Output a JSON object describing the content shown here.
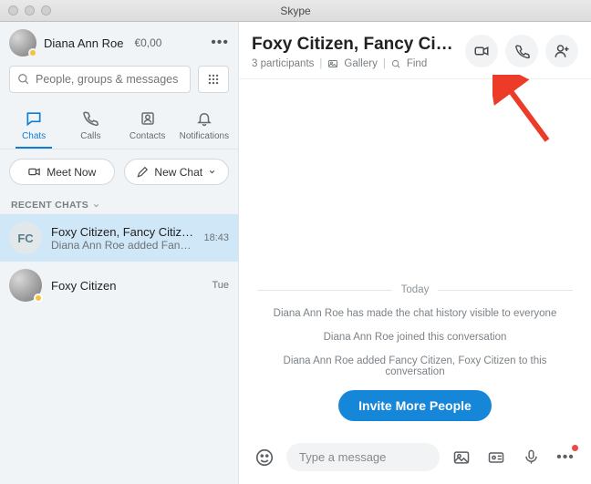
{
  "window": {
    "title": "Skype"
  },
  "me": {
    "name": "Diana Ann Roe",
    "balance": "€0,00"
  },
  "search": {
    "placeholder": "People, groups & messages"
  },
  "tabs": [
    {
      "id": "chats",
      "label": "Chats"
    },
    {
      "id": "calls",
      "label": "Calls"
    },
    {
      "id": "contacts",
      "label": "Contacts"
    },
    {
      "id": "notifications",
      "label": "Notifications"
    }
  ],
  "actions": {
    "meet_now": "Meet Now",
    "new_chat": "New Chat"
  },
  "section": {
    "recent": "RECENT CHATS"
  },
  "chats": [
    {
      "initials": "FC",
      "title": "Foxy Citizen, Fancy Citizen",
      "subtitle": "Diana Ann Roe added Fancy …",
      "time": "18:43",
      "selected": true
    },
    {
      "initials": "",
      "title": "Foxy Citizen",
      "subtitle": "",
      "time": "Tue",
      "selected": false
    }
  ],
  "conversation": {
    "title": "Foxy Citizen, Fancy Ci…",
    "participants": "3 participants",
    "gallery": "Gallery",
    "find": "Find",
    "day": "Today",
    "system": [
      "Diana Ann Roe has made the chat history visible to everyone",
      "Diana Ann Roe joined this conversation",
      "Diana Ann Roe added Fancy Citizen, Foxy Citizen to this conversation"
    ],
    "invite": "Invite More People"
  },
  "composer": {
    "placeholder": "Type a message"
  }
}
